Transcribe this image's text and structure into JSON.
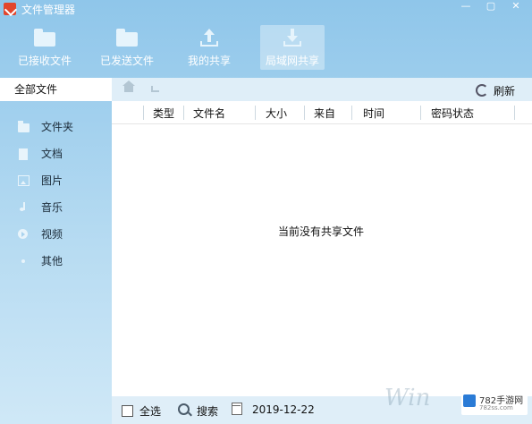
{
  "window": {
    "title": "文件管理器",
    "controls": {
      "min": "—",
      "max": "▢",
      "close": "✕"
    }
  },
  "toolbar": [
    {
      "label": "已接收文件",
      "icon": "received-folder-icon"
    },
    {
      "label": "已发送文件",
      "icon": "sent-folder-icon"
    },
    {
      "label": "我的共享",
      "icon": "upload-share-icon"
    },
    {
      "label": "局域网共享",
      "icon": "download-lan-icon",
      "active": true
    }
  ],
  "sidebar": {
    "all_files": "全部文件",
    "items": [
      {
        "label": "文件夹",
        "icon": "folder-icon"
      },
      {
        "label": "文档",
        "icon": "document-icon"
      },
      {
        "label": "图片",
        "icon": "image-icon"
      },
      {
        "label": "音乐",
        "icon": "music-icon"
      },
      {
        "label": "视频",
        "icon": "video-icon"
      },
      {
        "label": "其他",
        "icon": "other-icon"
      }
    ]
  },
  "nav": {
    "refresh_label": "刷新"
  },
  "columns": [
    "类型",
    "文件名",
    "大小",
    "来自",
    "时间",
    "密码状态"
  ],
  "empty_message": "当前没有共享文件",
  "bottom": {
    "select_all": "全选",
    "search": "搜索",
    "date": "2019-12-22"
  },
  "watermark": {
    "win_text": "Win",
    "site_text": "782手游网",
    "site_sub": "782ss.com"
  },
  "colors": {
    "title_bar": "#8fc6ea",
    "sidebar_bg": "#b8dcf2",
    "nav_bg": "#dfeef8",
    "main_bg": "#ffffff"
  }
}
